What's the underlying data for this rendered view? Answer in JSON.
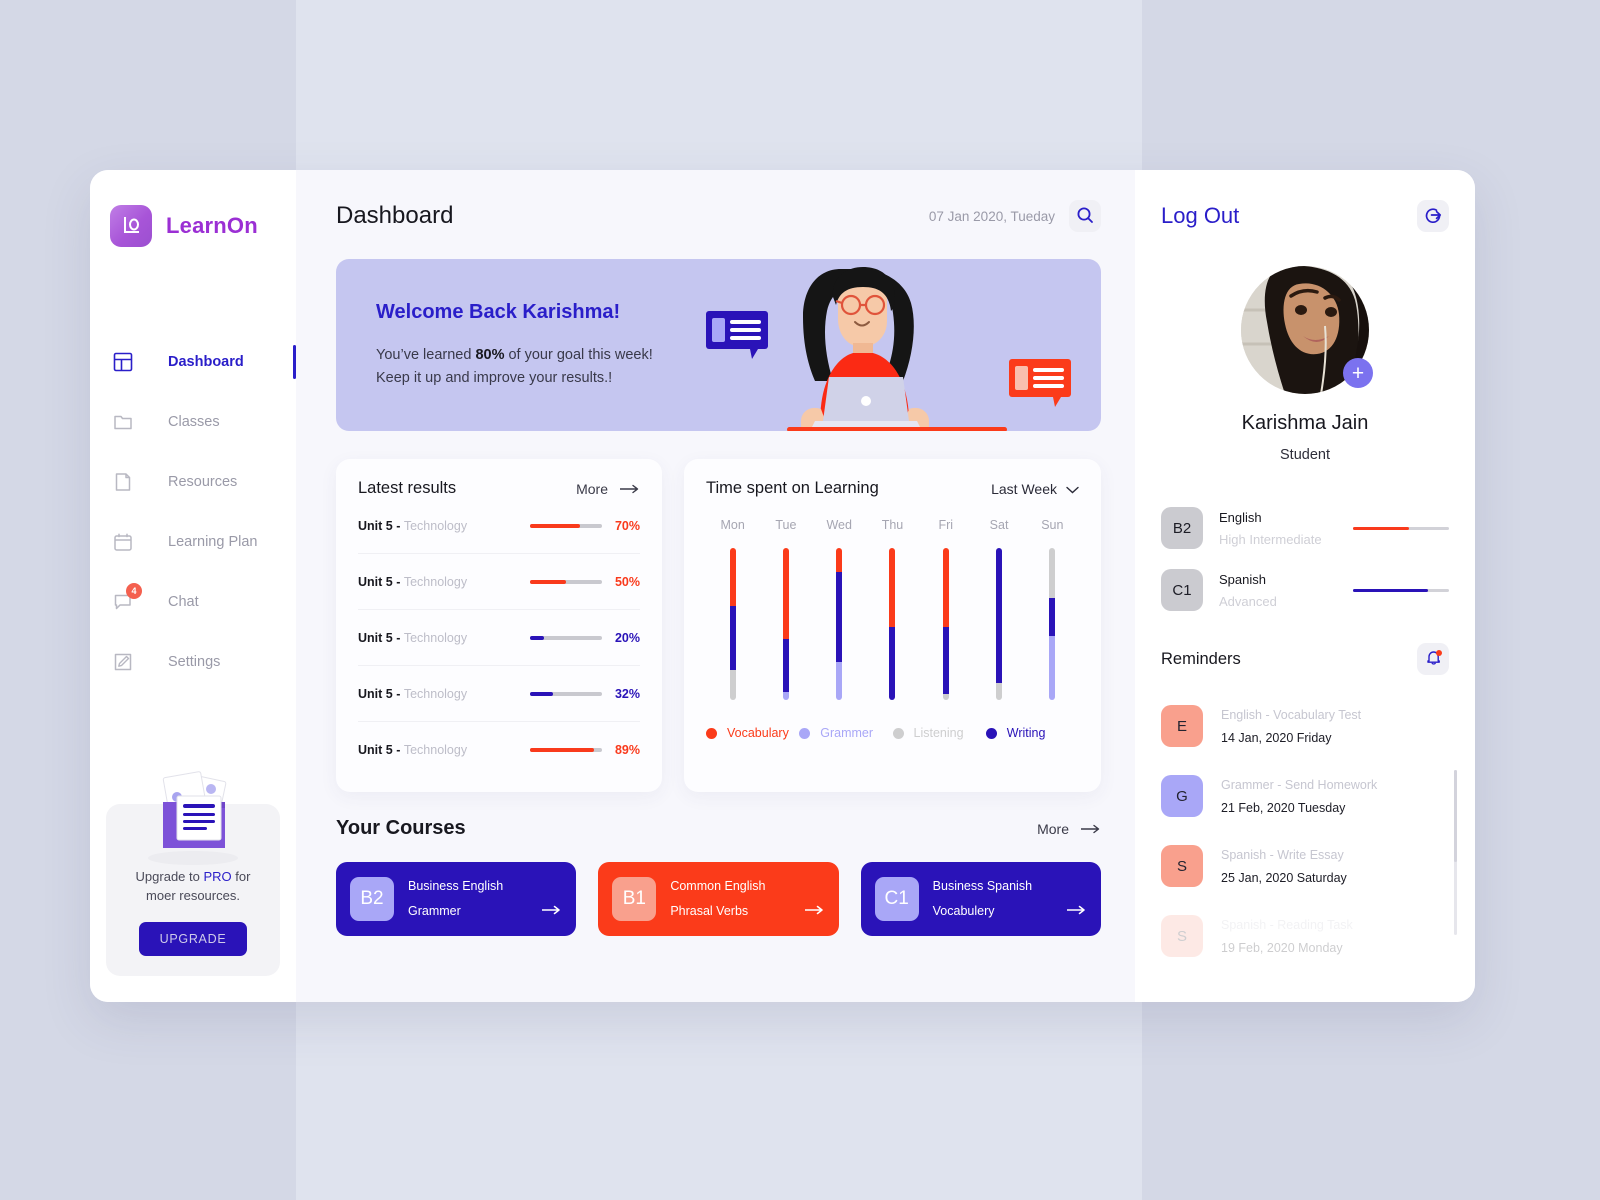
{
  "brand": {
    "name": "LearnOn",
    "logo_icon": "learnon-logo-icon"
  },
  "sidebar": {
    "items": [
      {
        "label": "Dashboard",
        "icon": "layout-dashboard-icon",
        "active": true,
        "badge": ""
      },
      {
        "label": "Classes",
        "icon": "folder-icon",
        "active": false,
        "badge": ""
      },
      {
        "label": "Resources",
        "icon": "file-icon",
        "active": false,
        "badge": ""
      },
      {
        "label": "Learning Plan",
        "icon": "calendar-icon",
        "active": false,
        "badge": ""
      },
      {
        "label": "Chat",
        "icon": "chat-bubble-icon",
        "active": false,
        "badge": "4"
      },
      {
        "label": "Settings",
        "icon": "edit-square-icon",
        "active": false,
        "badge": ""
      }
    ],
    "upgrade": {
      "text_before": "Upgrade to ",
      "pro": "PRO",
      "text_after": " for",
      "text_line2": "moer resources.",
      "button": "UPGRADE",
      "illustration_icon": "documents-stack-icon"
    }
  },
  "header": {
    "title": "Dashboard",
    "date": "07 Jan 2020, Tueday",
    "search_icon": "search-icon"
  },
  "banner": {
    "title": "Welcome Back Karishma!",
    "line1_a": "You’ve learned ",
    "line1_b": "80%",
    "line1_c": " of your goal this week!",
    "line2": "Keep it up and improve your results.!",
    "illustration_icon": "girl-with-laptop-illustration"
  },
  "latest_results": {
    "title": "Latest results",
    "more_label": "More",
    "more_icon": "arrow-right-icon",
    "rows": [
      {
        "name": "Unit 5 - ",
        "subject": "Technology",
        "pct": "70%",
        "value": 70,
        "color": "#f93a1c"
      },
      {
        "name": "Unit 5 - ",
        "subject": "Technology",
        "pct": "50%",
        "value": 50,
        "color": "#f93a1c"
      },
      {
        "name": "Unit 5 - ",
        "subject": "Technology",
        "pct": "20%",
        "value": 20,
        "color": "#2a13b8"
      },
      {
        "name": "Unit 5 - ",
        "subject": "Technology",
        "pct": "32%",
        "value": 32,
        "color": "#2a13b8"
      },
      {
        "name": "Unit 5 - ",
        "subject": "Technology",
        "pct": "89%",
        "value": 89,
        "color": "#f93a1c"
      }
    ]
  },
  "chart_data": {
    "type": "bar",
    "title": "Time spent on Learning",
    "subtitle": "",
    "range_selector": "Last Week",
    "range_icon": "chevron-down-icon",
    "xlabel": "",
    "ylabel": "",
    "grid": false,
    "legend_position": "bottom",
    "stacked": true,
    "categories": [
      "Mon",
      "Tue",
      "Wed",
      "Thu",
      "Fri",
      "Sat",
      "Sun"
    ],
    "series": [
      {
        "name": "Vocabulary",
        "color": "#fb3b1a",
        "values": [
          38,
          60,
          16,
          52,
          52,
          0,
          0
        ]
      },
      {
        "name": "Grammer",
        "color": "#a9a7f7",
        "values": [
          0,
          5,
          25,
          0,
          4,
          0,
          42
        ]
      },
      {
        "name": "Listening",
        "color": "#cececf",
        "values": [
          20,
          0,
          0,
          0,
          0,
          11,
          33
        ]
      },
      {
        "name": "Writing",
        "color": "#2a13b8",
        "values": [
          42,
          35,
          59,
          48,
          44,
          89,
          25
        ]
      }
    ],
    "stack_order_top_to_bottom": [
      "Listening",
      "Vocabulary",
      "Writing",
      "Grammer"
    ],
    "ylim": [
      0,
      100
    ],
    "bars": [
      {
        "day": "Mon",
        "segments": [
          {
            "series": "Vocabulary",
            "pct": 38
          },
          {
            "series": "Writing",
            "pct": 42
          },
          {
            "series": "Listening",
            "pct": 20
          }
        ]
      },
      {
        "day": "Tue",
        "segments": [
          {
            "series": "Vocabulary",
            "pct": 60
          },
          {
            "series": "Writing",
            "pct": 35
          },
          {
            "series": "Grammer",
            "pct": 5
          }
        ]
      },
      {
        "day": "Wed",
        "segments": [
          {
            "series": "Vocabulary",
            "pct": 16
          },
          {
            "series": "Writing",
            "pct": 59
          },
          {
            "series": "Grammer",
            "pct": 25
          }
        ]
      },
      {
        "day": "Thu",
        "segments": [
          {
            "series": "Vocabulary",
            "pct": 52
          },
          {
            "series": "Writing",
            "pct": 48
          }
        ]
      },
      {
        "day": "Fri",
        "segments": [
          {
            "series": "Vocabulary",
            "pct": 52
          },
          {
            "series": "Writing",
            "pct": 44
          },
          {
            "series": "Listening",
            "pct": 4
          }
        ]
      },
      {
        "day": "Sat",
        "segments": [
          {
            "series": "Writing",
            "pct": 89
          },
          {
            "series": "Listening",
            "pct": 11
          }
        ]
      },
      {
        "day": "Sun",
        "segments": [
          {
            "series": "Listening",
            "pct": 33
          },
          {
            "series": "Writing",
            "pct": 25
          },
          {
            "series": "Grammer",
            "pct": 42
          }
        ]
      }
    ],
    "legend": [
      {
        "name": "Vocabulary",
        "color": "#fb3b1a",
        "text_color": "#fb3b1a"
      },
      {
        "name": "Grammer",
        "color": "#a9a7f7",
        "text_color": "#a9a7f7"
      },
      {
        "name": "Listening",
        "color": "#cececf",
        "text_color": "#cececf"
      },
      {
        "name": "Writing",
        "color": "#2a13b8",
        "text_color": "#2a13b8"
      }
    ]
  },
  "courses": {
    "title": "Your Courses",
    "more_label": "More",
    "more_icon": "arrow-right-icon",
    "items": [
      {
        "badge": "B2",
        "line1": "Business English",
        "line2": "Grammer",
        "bg": "#2a13b8",
        "badge_bg": "#a9a7f7",
        "arrow_icon": "arrow-right-icon"
      },
      {
        "badge": "B1",
        "line1": "Common English",
        "line2": "Phrasal Verbs",
        "bg": "#fb3b1a",
        "badge_bg": "#f9a08d",
        "arrow_icon": "arrow-right-icon"
      },
      {
        "badge": "C1",
        "line1": "Business Spanish",
        "line2": "Vocabulery",
        "bg": "#2a13b8",
        "badge_bg": "#a9a7f7",
        "arrow_icon": "arrow-right-icon"
      }
    ]
  },
  "right_panel": {
    "logout_label": "Log Out",
    "logout_icon": "logout-arrow-icon",
    "avatar_icon": "user-avatar",
    "avatar_add_icon": "plus-icon",
    "user_name": "Karishma Jain",
    "user_role": "Student",
    "languages": [
      {
        "code": "B2",
        "name": "English",
        "level": "High Intermediate",
        "value": 58,
        "color": "#f93a1c"
      },
      {
        "code": "C1",
        "name": "Spanish",
        "level": "Advanced",
        "value": 78,
        "color": "#2a13b8"
      }
    ],
    "reminders_title": "Reminders",
    "reminders_bell_icon": "bell-icon",
    "reminders": [
      {
        "initial": "E",
        "badge_bg": "#f9a08d",
        "subject": "English - ",
        "task": "Vocabulary Test",
        "date": "14 Jan, 2020 Friday",
        "faded": false
      },
      {
        "initial": "G",
        "badge_bg": "#a9a7f7",
        "subject": "Grammer - ",
        "task": "Send Homework",
        "date": "21 Feb, 2020 Tuesday",
        "faded": false
      },
      {
        "initial": "S",
        "badge_bg": "#f9a08d",
        "subject": "Spanish - ",
        "task": "Write Essay",
        "date": "25 Jan, 2020 Saturday",
        "faded": false
      },
      {
        "initial": "S",
        "badge_bg": "#f9a08d",
        "subject": "Spanish - ",
        "task": "Reading Task",
        "date": "19 Feb, 2020 Monday",
        "faded": true
      }
    ]
  }
}
